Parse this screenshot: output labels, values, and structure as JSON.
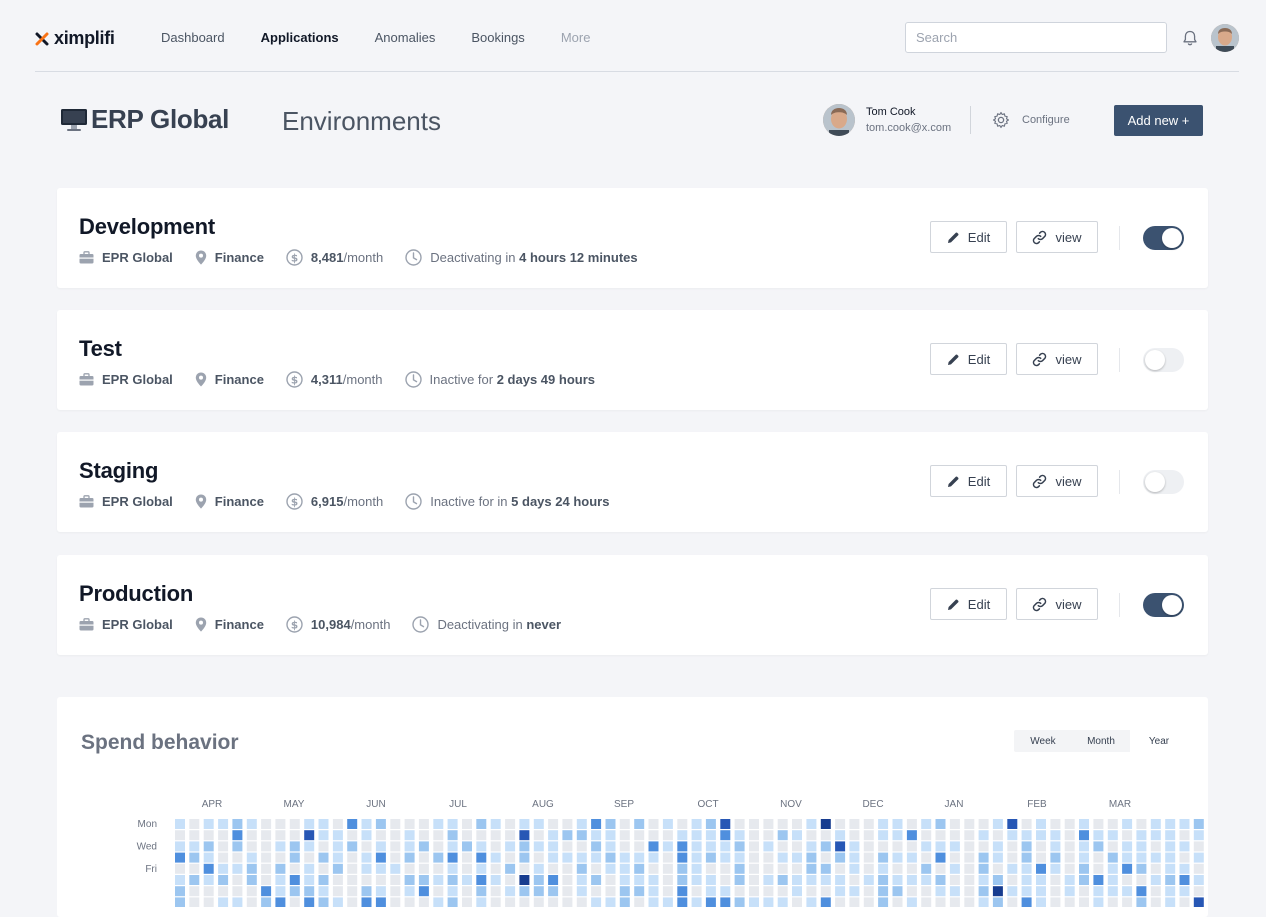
{
  "brand": {
    "name": "ximplifi"
  },
  "nav": {
    "items": [
      {
        "label": "Dashboard",
        "state": "normal"
      },
      {
        "label": "Applications",
        "state": "active"
      },
      {
        "label": "Anomalies",
        "state": "normal"
      },
      {
        "label": "Bookings",
        "state": "normal"
      },
      {
        "label": "More",
        "state": "muted"
      }
    ]
  },
  "search": {
    "placeholder": "Search",
    "value": ""
  },
  "header": {
    "app_name": "ERP Global",
    "section": "Environments",
    "user": {
      "name": "Tom Cook",
      "email": "tom.cook@x.com"
    },
    "configure_label": "Configure",
    "add_new_label": "Add new +"
  },
  "actions": {
    "edit_label": "Edit",
    "view_label": "view"
  },
  "environments": [
    {
      "name": "Development",
      "app": "EPR Global",
      "department": "Finance",
      "cost": "8,481",
      "cost_unit": "/month",
      "status_prefix": "Deactivating in",
      "status_value": "4 hours 12 minutes",
      "enabled": true
    },
    {
      "name": "Test",
      "app": "EPR Global",
      "department": "Finance",
      "cost": "4,311",
      "cost_unit": "/month",
      "status_prefix": "Inactive for",
      "status_value": "2 days 49 hours",
      "enabled": false
    },
    {
      "name": "Staging",
      "app": "EPR Global",
      "department": "Finance",
      "cost": "6,915",
      "cost_unit": "/month",
      "status_prefix": "Inactive for in",
      "status_value": "5 days 24 hours",
      "enabled": false
    },
    {
      "name": "Production",
      "app": "EPR Global",
      "department": "Finance",
      "cost": "10,984",
      "cost_unit": "/month",
      "status_prefix": "Deactivating in",
      "status_value": "never",
      "enabled": true
    }
  ],
  "spend": {
    "title": "Spend behavior",
    "ranges": [
      {
        "label": "Week",
        "active": false
      },
      {
        "label": "Month",
        "active": false
      },
      {
        "label": "Year",
        "active": true
      }
    ]
  },
  "chart_data": {
    "type": "heatmap",
    "title": "Spend behavior",
    "months": [
      "APR",
      "MAY",
      "JUN",
      "JUL",
      "AUG",
      "SEP",
      "OCT",
      "NOV",
      "DEC",
      "JAN",
      "FEB",
      "MAR"
    ],
    "day_labels": [
      "Mon",
      "Wed",
      "Fri"
    ],
    "levels": 5,
    "colors": [
      "#e6e9ee",
      "#c7e0f9",
      "#9cc6f0",
      "#4f8fde",
      "#2757b5",
      "#173c8f"
    ],
    "weeks": [
      [
        1,
        0,
        1,
        3,
        0,
        1,
        2,
        2
      ],
      [
        0,
        0,
        1,
        2,
        0,
        2,
        0,
        0
      ],
      [
        1,
        0,
        2,
        1,
        3,
        1,
        0,
        0
      ],
      [
        1,
        0,
        0,
        0,
        1,
        2,
        0,
        1
      ],
      [
        2,
        3,
        2,
        0,
        1,
        0,
        0,
        1
      ],
      [
        1,
        0,
        0,
        1,
        2,
        2,
        0,
        0
      ],
      [
        0,
        0,
        0,
        0,
        0,
        0,
        3,
        2
      ],
      [
        0,
        0,
        1,
        0,
        2,
        1,
        1,
        3
      ],
      [
        0,
        0,
        2,
        2,
        0,
        3,
        2,
        0
      ],
      [
        1,
        4,
        1,
        0,
        1,
        1,
        2,
        3
      ],
      [
        1,
        1,
        0,
        2,
        0,
        2,
        1,
        2
      ],
      [
        0,
        1,
        1,
        1,
        2,
        0,
        0,
        1
      ],
      [
        3,
        0,
        2,
        0,
        0,
        0,
        0,
        0
      ],
      [
        1,
        1,
        0,
        1,
        1,
        0,
        2,
        3
      ],
      [
        2,
        0,
        1,
        3,
        1,
        0,
        1,
        3
      ],
      [
        0,
        0,
        0,
        0,
        1,
        0,
        0,
        0
      ],
      [
        0,
        1,
        1,
        2,
        0,
        2,
        1,
        0
      ],
      [
        0,
        0,
        2,
        0,
        0,
        2,
        3,
        0
      ],
      [
        1,
        0,
        0,
        2,
        0,
        1,
        0,
        1
      ],
      [
        1,
        2,
        1,
        3,
        1,
        2,
        1,
        2
      ],
      [
        0,
        0,
        2,
        0,
        0,
        1,
        0,
        0
      ],
      [
        2,
        0,
        1,
        3,
        1,
        3,
        2,
        1
      ],
      [
        1,
        0,
        0,
        1,
        0,
        1,
        0,
        0
      ],
      [
        0,
        0,
        1,
        0,
        2,
        0,
        1,
        0
      ],
      [
        1,
        4,
        2,
        2,
        0,
        5,
        2,
        0
      ],
      [
        1,
        0,
        1,
        0,
        1,
        2,
        2,
        0
      ],
      [
        0,
        1,
        1,
        1,
        0,
        3,
        2,
        0
      ],
      [
        0,
        2,
        0,
        1,
        0,
        0,
        0,
        0
      ],
      [
        1,
        2,
        0,
        1,
        2,
        1,
        1,
        0
      ],
      [
        3,
        1,
        2,
        1,
        0,
        2,
        0,
        1
      ],
      [
        2,
        1,
        1,
        2,
        1,
        0,
        0,
        1
      ],
      [
        0,
        0,
        0,
        1,
        1,
        1,
        2,
        2
      ],
      [
        2,
        0,
        0,
        1,
        2,
        1,
        2,
        0
      ],
      [
        0,
        0,
        3,
        1,
        0,
        1,
        1,
        1
      ],
      [
        1,
        0,
        1,
        0,
        0,
        0,
        0,
        1
      ],
      [
        0,
        1,
        3,
        3,
        2,
        2,
        3,
        3
      ],
      [
        1,
        1,
        1,
        1,
        1,
        1,
        0,
        1
      ],
      [
        2,
        1,
        1,
        2,
        0,
        1,
        1,
        3
      ],
      [
        4,
        3,
        1,
        1,
        0,
        0,
        1,
        3
      ],
      [
        0,
        1,
        2,
        1,
        2,
        2,
        0,
        2
      ],
      [
        0,
        0,
        0,
        0,
        0,
        0,
        0,
        1
      ],
      [
        0,
        0,
        1,
        0,
        0,
        1,
        0,
        1
      ],
      [
        0,
        2,
        0,
        1,
        0,
        2,
        0,
        1
      ],
      [
        0,
        1,
        0,
        1,
        0,
        1,
        1,
        0
      ],
      [
        1,
        0,
        1,
        2,
        2,
        1,
        0,
        1
      ],
      [
        5,
        0,
        2,
        0,
        2,
        1,
        0,
        3
      ],
      [
        0,
        1,
        4,
        2,
        0,
        1,
        1,
        0
      ],
      [
        0,
        0,
        1,
        1,
        1,
        0,
        1,
        0
      ],
      [
        0,
        0,
        0,
        0,
        0,
        1,
        0,
        0
      ],
      [
        1,
        1,
        0,
        2,
        1,
        2,
        2,
        2
      ],
      [
        1,
        1,
        0,
        1,
        0,
        1,
        2,
        0
      ],
      [
        0,
        3,
        0,
        1,
        0,
        1,
        0,
        1
      ],
      [
        1,
        0,
        1,
        0,
        2,
        1,
        0,
        0
      ],
      [
        2,
        0,
        1,
        3,
        0,
        2,
        1,
        0
      ],
      [
        0,
        0,
        1,
        0,
        1,
        0,
        1,
        0
      ],
      [
        0,
        0,
        0,
        0,
        0,
        0,
        0,
        0
      ],
      [
        0,
        1,
        0,
        2,
        2,
        1,
        2,
        1
      ],
      [
        1,
        0,
        1,
        1,
        0,
        2,
        5,
        2
      ],
      [
        4,
        1,
        0,
        0,
        1,
        0,
        1,
        0
      ],
      [
        0,
        1,
        2,
        2,
        1,
        1,
        1,
        3
      ],
      [
        1,
        1,
        0,
        0,
        3,
        1,
        1,
        1
      ],
      [
        0,
        1,
        1,
        2,
        1,
        0,
        0,
        0
      ],
      [
        0,
        0,
        0,
        0,
        0,
        1,
        1,
        0
      ],
      [
        1,
        3,
        1,
        1,
        2,
        2,
        0,
        0
      ],
      [
        0,
        1,
        2,
        0,
        0,
        3,
        1,
        1
      ],
      [
        0,
        1,
        0,
        2,
        1,
        1,
        1,
        0
      ],
      [
        1,
        0,
        1,
        1,
        3,
        0,
        1,
        0
      ],
      [
        0,
        1,
        1,
        1,
        2,
        0,
        3,
        2
      ],
      [
        1,
        1,
        0,
        1,
        0,
        1,
        0,
        0
      ],
      [
        1,
        1,
        1,
        1,
        1,
        2,
        1,
        1
      ],
      [
        1,
        0,
        1,
        0,
        1,
        3,
        1,
        0
      ],
      [
        2,
        1,
        0,
        1,
        0,
        1,
        0,
        4
      ],
      [
        1,
        2,
        1,
        2,
        1,
        1,
        2,
        0
      ],
      [
        0,
        1,
        2,
        0,
        1,
        1,
        2,
        1
      ],
      [
        1,
        0,
        1,
        2,
        0,
        1,
        1,
        1
      ],
      [
        1,
        1,
        2,
        1,
        1,
        0,
        0,
        1
      ],
      [
        0,
        2,
        1,
        1,
        2,
        1,
        2,
        2
      ]
    ]
  }
}
